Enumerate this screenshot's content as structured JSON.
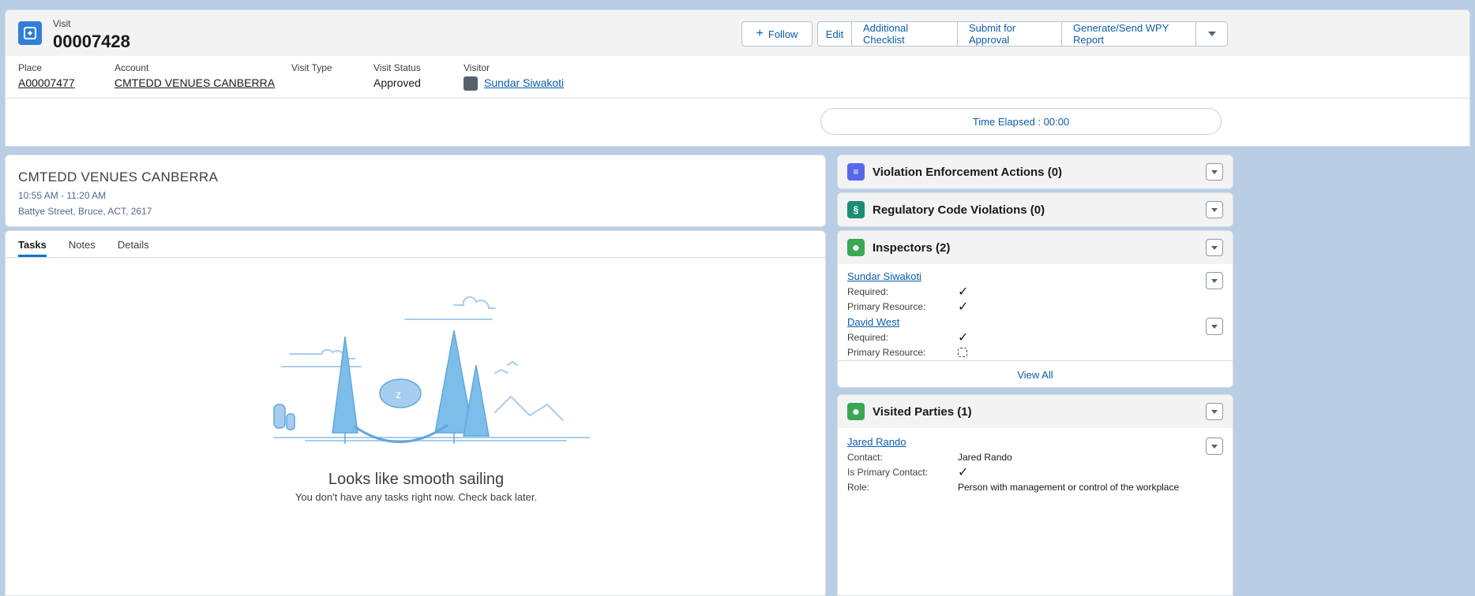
{
  "header": {
    "object_type": "Visit",
    "record_name": "00007428",
    "buttons": {
      "follow": "Follow",
      "edit": "Edit",
      "additional_checklist": "Additional Checklist",
      "submit_for_approval": "Submit for Approval",
      "generate_report": "Generate/Send WPY Report"
    },
    "fields": {
      "place_label": "Place",
      "place_value": "A00007477",
      "account_label": "Account",
      "account_value": "CMTEDD VENUES CANBERRA",
      "visit_type_label": "Visit Type",
      "visit_status_label": "Visit Status",
      "visit_status_value": "Approved",
      "visitor_label": "Visitor",
      "visitor_value": "Sundar Siwakoti"
    }
  },
  "timer": {
    "text": "Time Elapsed : 00:00"
  },
  "location": {
    "name": "CMTEDD VENUES CANBERRA",
    "time": "10:55 AM - 11:20 AM",
    "address": "Battye Street, Bruce, ACT, 2617"
  },
  "tasks": {
    "tabs": [
      "Tasks",
      "Notes",
      "Details"
    ],
    "empty_title": "Looks like smooth sailing",
    "empty_subtitle": "You don't have any tasks right now. Check back later."
  },
  "related": {
    "violation_actions": {
      "title": "Violation Enforcement Actions (0)",
      "icon_color": "#5867e8"
    },
    "code_violations": {
      "title": "Regulatory Code Violations (0)",
      "icon_color": "#1b8d73"
    },
    "inspectors": {
      "title": "Inspectors (2)",
      "icon_color": "#3ba755",
      "records": [
        {
          "name": "Sundar Siwakoti",
          "required_label": "Required:",
          "required": true,
          "primary_label": "Primary Resource:",
          "primary": true
        },
        {
          "name": "David West",
          "required_label": "Required:",
          "required": true,
          "primary_label": "Primary Resource:",
          "primary": false
        }
      ],
      "view_all": "View All"
    },
    "visited_parties": {
      "title": "Visited Parties (1)",
      "icon_color": "#3ba755",
      "records": [
        {
          "name": "Jared Rando",
          "contact_label": "Contact:",
          "contact_value": "Jared Rando",
          "primary_label": "Is Primary Contact:",
          "primary": true,
          "role_label": "Role:",
          "role_value": "Person with management or control of the workplace"
        }
      ]
    }
  }
}
